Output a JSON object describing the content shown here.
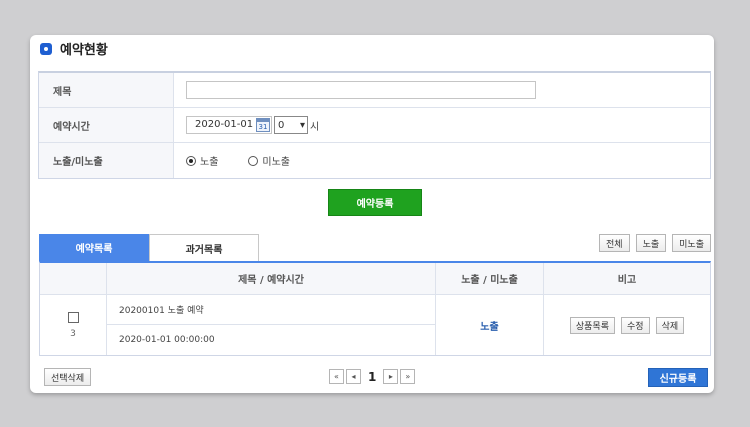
{
  "page": {
    "title": "예약현황"
  },
  "form": {
    "subject_label": "제목",
    "subject_value": "",
    "time_label": "예약시간",
    "date_value": "2020-01-01",
    "calendar_day": "31",
    "hour_value": "0",
    "hour_unit": "시",
    "expose_label": "노출/미노출",
    "radio_expose": "노출",
    "radio_hide": "미노출"
  },
  "actions": {
    "reserve_button": "예약등록"
  },
  "tabs": [
    {
      "label": "예약목록",
      "active": true
    },
    {
      "label": "과거목록",
      "active": false
    }
  ],
  "filters": [
    "전체",
    "노출",
    "미노출"
  ],
  "table": {
    "headers": [
      "",
      "제목 / 예약시간",
      "노출 / 미노출",
      "비고"
    ],
    "rows": [
      {
        "number": "3",
        "title": "20200101 노출 예약",
        "time": "2020-01-01 00:00:00",
        "status": "노출",
        "buttons": [
          "상품목록",
          "수정",
          "삭제"
        ]
      }
    ]
  },
  "footer": {
    "bulk_delete": "선택삭제",
    "page": "1",
    "pager_first": "«",
    "pager_prev": "◂",
    "pager_next": "▸",
    "pager_last": "»",
    "new_button": "신규등록"
  },
  "colors": {
    "accent": "#4a86e8",
    "green": "#1fa21f",
    "blue_button": "#2f75d6"
  }
}
